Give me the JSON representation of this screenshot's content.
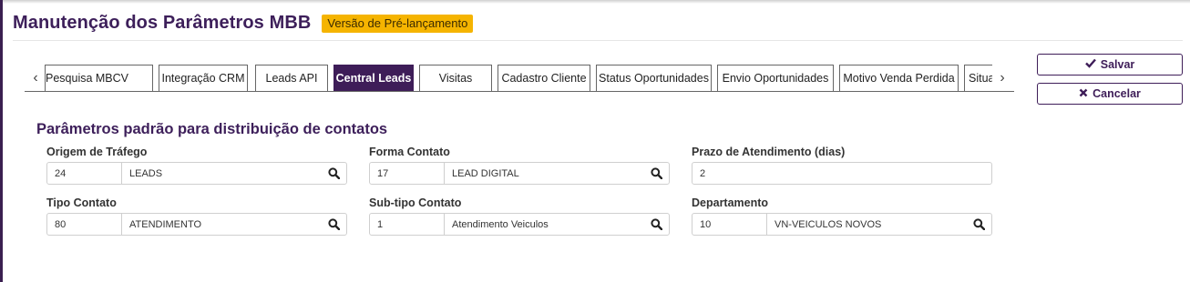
{
  "page": {
    "title": "Manutenção dos Parâmetros MBB",
    "badge": "Versão de Pré-lançamento"
  },
  "tabs": [
    {
      "label": "Pesquisa MBCV",
      "active": false
    },
    {
      "label": "Integração CRM",
      "active": false
    },
    {
      "label": "Leads API",
      "active": false
    },
    {
      "label": "Central Leads",
      "active": true
    },
    {
      "label": "Visitas",
      "active": false
    },
    {
      "label": "Cadastro Cliente",
      "active": false
    },
    {
      "label": "Status Oportunidades",
      "active": false
    },
    {
      "label": "Envio Oportunidades",
      "active": false
    },
    {
      "label": "Motivo Venda Perdida",
      "active": false
    },
    {
      "label": "Situaçã",
      "active": false
    }
  ],
  "tab_nav": {
    "prev": "‹",
    "next": "›"
  },
  "actions": {
    "save_label": "Salvar",
    "cancel_label": "Cancelar"
  },
  "section": {
    "title": "Parâmetros padrão para distribuição de contatos"
  },
  "fields": {
    "origem": {
      "label": "Origem de Tráfego",
      "code": "24",
      "desc": "LEADS"
    },
    "forma": {
      "label": "Forma Contato",
      "code": "17",
      "desc": "LEAD DIGITAL"
    },
    "prazo": {
      "label": "Prazo de Atendimento (dias)",
      "value": "2"
    },
    "tipo": {
      "label": "Tipo Contato",
      "code": "80",
      "desc": "ATENDIMENTO"
    },
    "subtipo": {
      "label": "Sub-tipo Contato",
      "code": "1",
      "desc": "Atendimento Veiculos"
    },
    "departamento": {
      "label": "Departamento",
      "code": "10",
      "desc": "VN-VEICULOS NOVOS"
    }
  },
  "colors": {
    "brand": "#3e1d58",
    "badge": "#f5b400"
  },
  "icons": {
    "save": "check-icon",
    "cancel": "x-icon",
    "lookup": "search-icon"
  }
}
